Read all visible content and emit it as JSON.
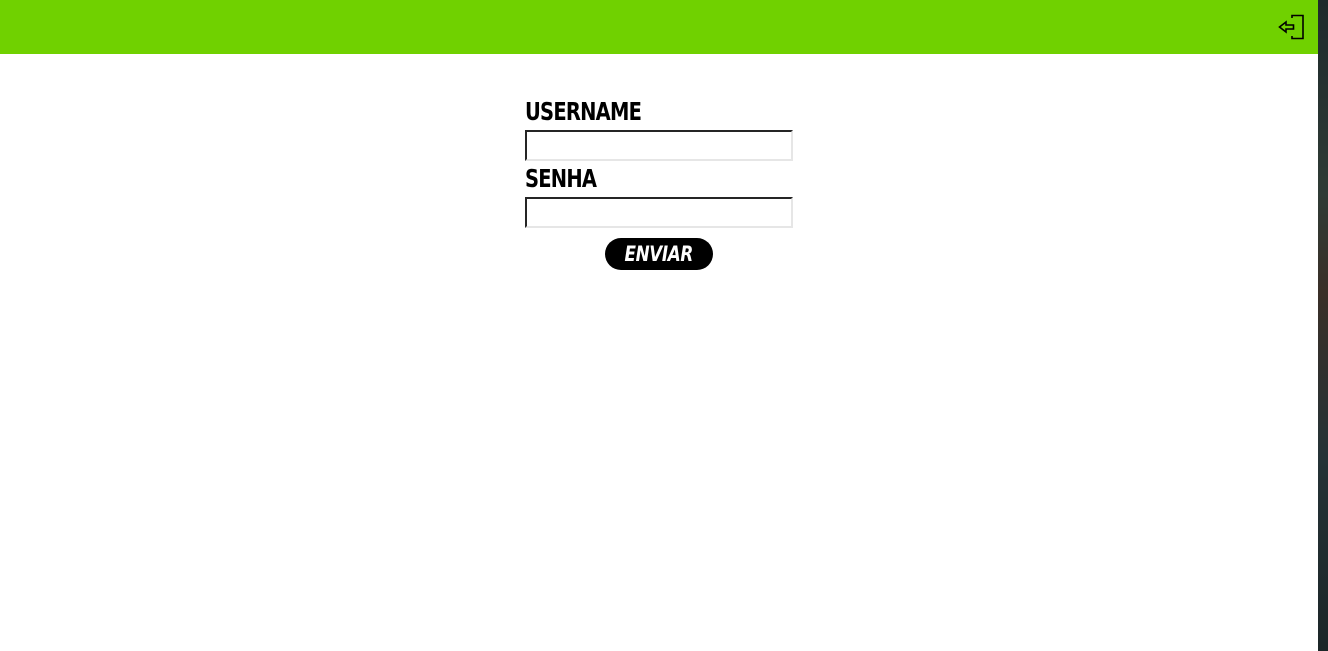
{
  "header": {
    "logout_icon": "logout-icon",
    "accent_color": "#70d100"
  },
  "form": {
    "username_label": "USERNAME",
    "username_value": "",
    "password_label": "SENHA",
    "password_value": "",
    "submit_label": "ENVIAR"
  }
}
